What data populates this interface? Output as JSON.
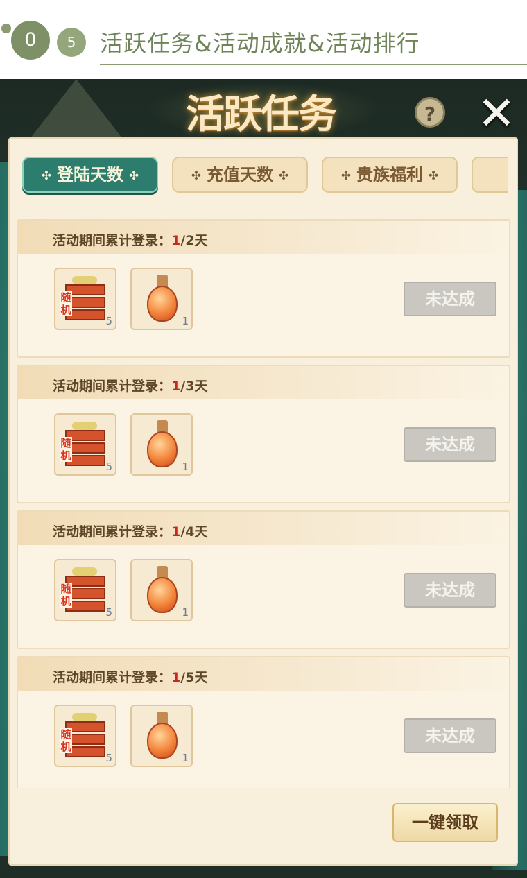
{
  "header": {
    "num_a": "0",
    "num_b": "5",
    "title": "活跃任务&活动成就&活动排行"
  },
  "scene": {
    "title": "活跃任务",
    "help_label": "?",
    "close_label": "✕"
  },
  "tabs": [
    {
      "label": "登陆天数",
      "active": true
    },
    {
      "label": "充值天数",
      "active": false
    },
    {
      "label": "贵族福利",
      "active": false
    },
    {
      "label": "",
      "active": false
    }
  ],
  "tab_deco": "✣",
  "tasks": [
    {
      "label": "活动期间累计登录：",
      "current": "1",
      "target": "/2天",
      "rewards": [
        {
          "icon": "random-gift-box-icon",
          "badge": "随机",
          "qty": "5"
        },
        {
          "icon": "orange-potion-bottle-icon",
          "qty": "1"
        }
      ],
      "button": "未达成"
    },
    {
      "label": "活动期间累计登录：",
      "current": "1",
      "target": "/3天",
      "rewards": [
        {
          "icon": "random-gift-box-icon",
          "badge": "随机",
          "qty": "5"
        },
        {
          "icon": "orange-potion-bottle-icon",
          "qty": "1"
        }
      ],
      "button": "未达成"
    },
    {
      "label": "活动期间累计登录：",
      "current": "1",
      "target": "/4天",
      "rewards": [
        {
          "icon": "random-gift-box-icon",
          "badge": "随机",
          "qty": "5"
        },
        {
          "icon": "orange-potion-bottle-icon",
          "qty": "1"
        }
      ],
      "button": "未达成"
    },
    {
      "label": "活动期间累计登录：",
      "current": "1",
      "target": "/5天",
      "rewards": [
        {
          "icon": "random-gift-box-icon",
          "badge": "随机",
          "qty": "5"
        },
        {
          "icon": "orange-potion-bottle-icon",
          "qty": "1"
        }
      ],
      "button": "未达成"
    }
  ],
  "claim_all_label": "一键领取",
  "colors": {
    "accent": "#7e9166",
    "tab_active": "#2d7d6e",
    "progress_current": "#c5291f",
    "disabled_button": "#c9c7c0"
  }
}
